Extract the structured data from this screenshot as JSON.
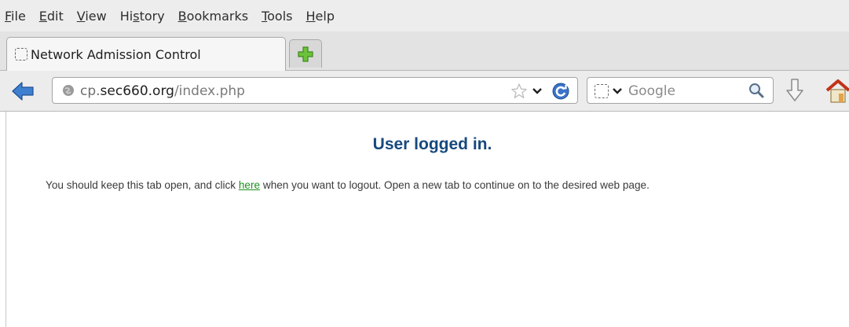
{
  "menubar": {
    "items": [
      {
        "pre": "",
        "key": "F",
        "post": "ile"
      },
      {
        "pre": "",
        "key": "E",
        "post": "dit"
      },
      {
        "pre": "",
        "key": "V",
        "post": "iew"
      },
      {
        "pre": "Hi",
        "key": "s",
        "post": "tory"
      },
      {
        "pre": "",
        "key": "B",
        "post": "ookmarks"
      },
      {
        "pre": "",
        "key": "T",
        "post": "ools"
      },
      {
        "pre": "",
        "key": "H",
        "post": "elp"
      }
    ]
  },
  "tab": {
    "title": "Network Admission Control"
  },
  "navbar": {
    "url_prefix": "cp.",
    "url_host": "sec660.org",
    "url_path": "/index.php",
    "search_placeholder": "Google"
  },
  "icons": {
    "tab": "page-icon",
    "new_tab": "plus-icon",
    "back": "back-arrow-icon",
    "site": "globe-icon",
    "bookmark": "star-icon",
    "reload": "reload-icon",
    "search": "magnifier-icon",
    "downloads": "download-arrow-icon",
    "home": "home-icon"
  },
  "colors": {
    "heading": "#17497e",
    "link": "#1c8f1c",
    "accent_blue": "#2e6fc4",
    "new_tab_green": "#58b028",
    "home_red": "#d23a1a"
  },
  "content": {
    "heading": "User logged in.",
    "message_before": "You should keep this tab open, and click ",
    "link_text": "here",
    "message_after": " when you want to logout. Open a new tab to continue on to the desired web page."
  }
}
